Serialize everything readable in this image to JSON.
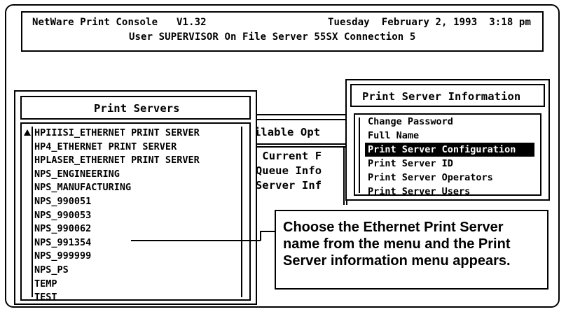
{
  "header": {
    "app": "NetWare Print Console",
    "version": "V1.32",
    "datetime": "Tuesday  February 2, 1993  3:18 pm",
    "status": "User SUPERVISOR On File Server 55SX Connection 5"
  },
  "print_servers": {
    "title": "Print Servers",
    "items": [
      "HPIIISI_ETHERNET PRINT SERVER",
      "HP4_ETHERNET PRINT SERVER",
      "HPLASER_ETHERNET PRINT SERVER",
      "NPS_ENGINEERING",
      "NPS_MANUFACTURING",
      "NPS_990051",
      "NPS_990053",
      "NPS_990062",
      "NPS_991354",
      "NPS_999999",
      "NPS_PS",
      "TEMP",
      "TEST"
    ]
  },
  "background_menu": {
    "title_fragment": "vailable Opt",
    "items": [
      "ge Current F",
      "t Queue Info",
      "t Server Inf"
    ]
  },
  "info_menu": {
    "title": "Print Server Information",
    "items": [
      "Change Password",
      "Full Name",
      "Print Server Configuration",
      "Print Server ID",
      "Print Server Operators",
      "Print Server Users"
    ],
    "selected_index": 2
  },
  "callout": {
    "text": "Choose the Ethernet Print Server name from the menu and the Print Server information menu appears."
  }
}
